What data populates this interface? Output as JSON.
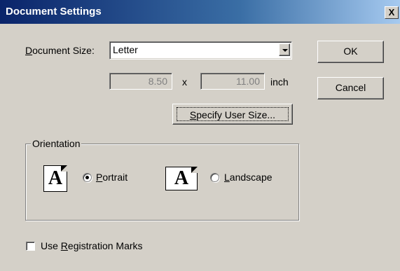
{
  "window": {
    "title": "Document Settings",
    "close_glyph": "X"
  },
  "document_size": {
    "label_underlined": "D",
    "label_rest": "ocument Size:",
    "selected": "Letter",
    "width_value": "8.50",
    "times_sign": "x",
    "height_value": "11.00",
    "unit": "inch"
  },
  "specify_user_size": {
    "underlined": "S",
    "rest": "pecify User Size..."
  },
  "buttons": {
    "ok": "OK",
    "cancel": "Cancel"
  },
  "orientation": {
    "group_label": "Orientation",
    "icon_letter": "A",
    "portrait": {
      "underlined": "P",
      "rest": "ortrait",
      "selected": true
    },
    "landscape": {
      "underlined": "L",
      "rest": "andscape",
      "selected": false
    }
  },
  "registration": {
    "prefix": "Use ",
    "underlined": "R",
    "rest": "egistration Marks",
    "checked": false
  }
}
